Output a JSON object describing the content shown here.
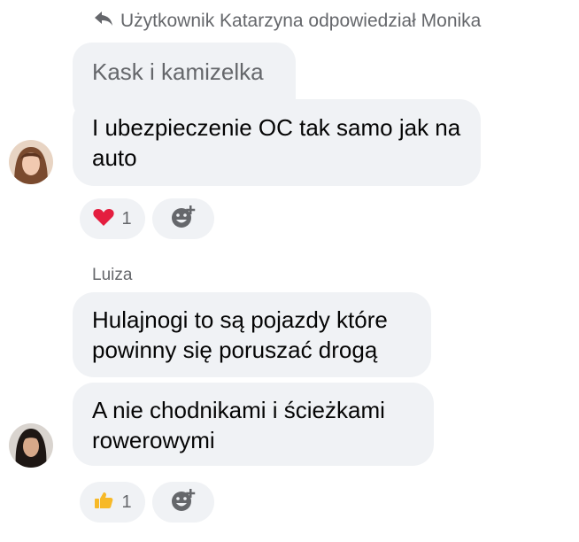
{
  "reply_header": {
    "text": "Użytkownik Katarzyna odpowiedział Monika"
  },
  "group1": {
    "quoted_message": "Kask i kamizelka",
    "message": "I ubezpieczenie OC tak samo jak na auto",
    "reaction": {
      "icon": "heart-icon",
      "count": "1",
      "color": "#e41e3f"
    }
  },
  "group2": {
    "sender": "Luiza",
    "messages": [
      "Hulajnogi to są pojazdy które powinny się poruszać drogą",
      "A nie chodnikami i ścieżkami rowerowymi"
    ],
    "reaction": {
      "icon": "thumbs-up-icon",
      "count": "1",
      "color": "#f7b928"
    }
  },
  "colors": {
    "bubble_bg": "#f0f2f5",
    "secondary_text": "#65676b",
    "primary_text": "#050505"
  }
}
